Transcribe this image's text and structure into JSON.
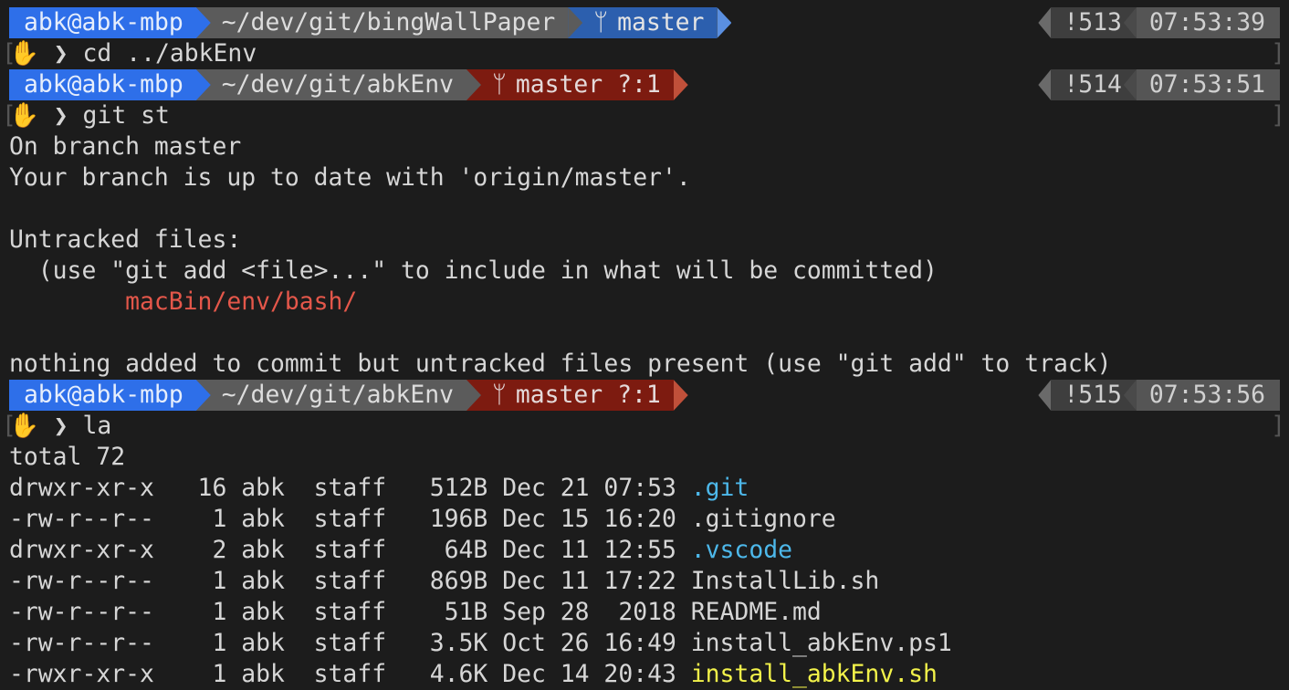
{
  "prompts": [
    {
      "user": "abk@abk-mbp",
      "path": "~/dev/git/bingWallPaper",
      "branch": "master",
      "status": "",
      "hist": "!513",
      "time": "07:53:39",
      "dirty": false
    },
    {
      "user": "abk@abk-mbp",
      "path": "~/dev/git/abkEnv",
      "branch": "master",
      "status": "?:1",
      "hist": "!514",
      "time": "07:53:51",
      "dirty": true
    },
    {
      "user": "abk@abk-mbp",
      "path": "~/dev/git/abkEnv",
      "branch": "master",
      "status": "?:1",
      "hist": "!515",
      "time": "07:53:56",
      "dirty": true
    }
  ],
  "commands": [
    "cd ../abkEnv",
    "git st",
    "la"
  ],
  "prompt_symbol": "❯",
  "hand_icon": "✋",
  "git_status": {
    "line1": "On branch master",
    "line2": "Your branch is up to date with 'origin/master'.",
    "line3": "Untracked files:",
    "line4": "  (use \"git add <file>...\" to include in what will be committed)",
    "untracked": "macBin/env/bash/",
    "line5": "nothing added to commit but untracked files present (use \"git add\" to track)"
  },
  "ls": {
    "total": "total 72",
    "files": [
      {
        "perm": "drwxr-xr-x",
        "links": "16",
        "owner": "abk",
        "group": "staff",
        "size": "512B",
        "date": "Dec 21 07:53",
        "name": ".git",
        "kind": "dir"
      },
      {
        "perm": "-rw-r--r--",
        "links": "1",
        "owner": "abk",
        "group": "staff",
        "size": "196B",
        "date": "Dec 15 16:20",
        "name": ".gitignore",
        "kind": "file"
      },
      {
        "perm": "drwxr-xr-x",
        "links": "2",
        "owner": "abk",
        "group": "staff",
        "size": "64B",
        "date": "Dec 11 12:55",
        "name": ".vscode",
        "kind": "dir"
      },
      {
        "perm": "-rw-r--r--",
        "links": "1",
        "owner": "abk",
        "group": "staff",
        "size": "869B",
        "date": "Dec 11 17:22",
        "name": "InstallLib.sh",
        "kind": "file"
      },
      {
        "perm": "-rw-r--r--",
        "links": "1",
        "owner": "abk",
        "group": "staff",
        "size": "51B",
        "date": "Sep 28  2018",
        "name": "README.md",
        "kind": "file"
      },
      {
        "perm": "-rw-r--r--",
        "links": "1",
        "owner": "abk",
        "group": "staff",
        "size": "3.5K",
        "date": "Oct 26 16:49",
        "name": "install_abkEnv.ps1",
        "kind": "file"
      },
      {
        "perm": "-rwxr-xr-x",
        "links": "1",
        "owner": "abk",
        "group": "staff",
        "size": "4.6K",
        "date": "Dec 14 20:43",
        "name": "install_abkEnv.sh",
        "kind": "exe"
      }
    ]
  },
  "colors": {
    "user": "#2e6fe9",
    "path": "#5b5b5b",
    "branch_clean": "#2c5fae",
    "branch_dirty": "#7d1b10",
    "dir": "#4db8ea",
    "exe": "#f2f24a",
    "untracked": "#e4574a"
  }
}
